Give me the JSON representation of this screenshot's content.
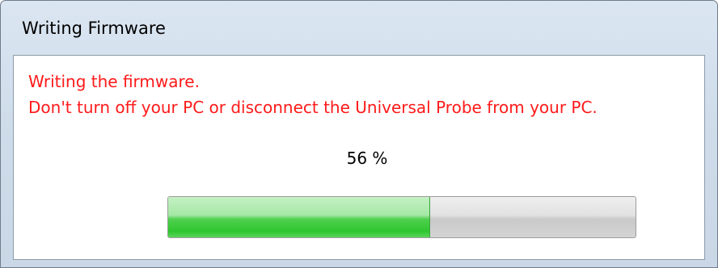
{
  "window": {
    "title": "Writing Firmware"
  },
  "messages": {
    "line1": "Writing the firmware.",
    "line2": "Don't turn off your PC or disconnect the Universal Probe from your PC."
  },
  "progress": {
    "label": "56 %",
    "percent": 56
  }
}
